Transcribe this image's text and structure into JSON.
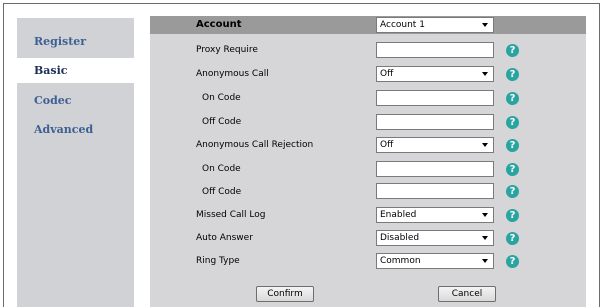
{
  "sidebar": {
    "items": [
      {
        "label": "Register",
        "active": false
      },
      {
        "label": "Basic",
        "active": true
      },
      {
        "label": "Codec",
        "active": false
      },
      {
        "label": "Advanced",
        "active": false
      }
    ]
  },
  "form": {
    "header": {
      "label": "Account",
      "value": "Account 1"
    },
    "rows": [
      {
        "label": "Proxy Require",
        "type": "text",
        "value": ""
      },
      {
        "label": "Anonymous Call",
        "type": "select",
        "value": "Off"
      },
      {
        "label": "On Code",
        "type": "text",
        "value": ""
      },
      {
        "label": "Off Code",
        "type": "text",
        "value": ""
      },
      {
        "label": "Anonymous Call Rejection",
        "type": "select",
        "value": "Off"
      },
      {
        "label": "On Code",
        "type": "text",
        "value": ""
      },
      {
        "label": "Off Code",
        "type": "text",
        "value": ""
      },
      {
        "label": "Missed Call Log",
        "type": "select",
        "value": "Enabled"
      },
      {
        "label": "Auto Answer",
        "type": "select",
        "value": "Disabled"
      },
      {
        "label": "Ring Type",
        "type": "select",
        "value": "Common"
      }
    ],
    "help_icon": "?",
    "confirm_label": "Confirm",
    "cancel_label": "Cancel"
  },
  "colors": {
    "sidebar_bg": "#d0d2d6",
    "content_bg": "#d6d6d8",
    "header_bar": "#9a9a9a",
    "nav_text": "#3e5f92",
    "help_icon": "#2aa4a0"
  }
}
